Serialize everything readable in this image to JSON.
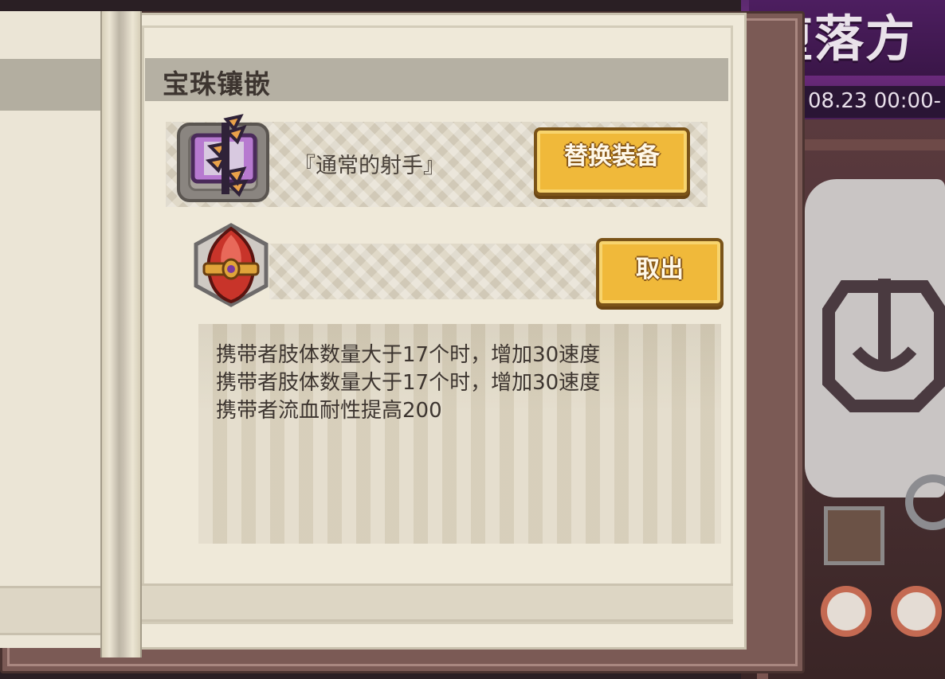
{
  "background_scene": {
    "banner_title": "堕落方",
    "event_date": "08.23 00:00-"
  },
  "panel": {
    "section_title": "宝珠镶嵌",
    "equipment": {
      "name": "『通常的射手』",
      "icon": "crossbow-icon",
      "swap_button": "替换装备"
    },
    "gem": {
      "icon": "red-gem-icon",
      "remove_button": "取出"
    },
    "description_lines": [
      "携带者肢体数量大于17个时，增加30速度",
      "携带者肢体数量大于17个时，增加30速度",
      "携带者流血耐性提高200"
    ]
  },
  "colors": {
    "page": "#efe9d9",
    "header_bar": "#b5b0a3",
    "button_gold": "#f0b93a",
    "frame_brown": "#7b5a55",
    "gem_red": "#c8342a"
  }
}
